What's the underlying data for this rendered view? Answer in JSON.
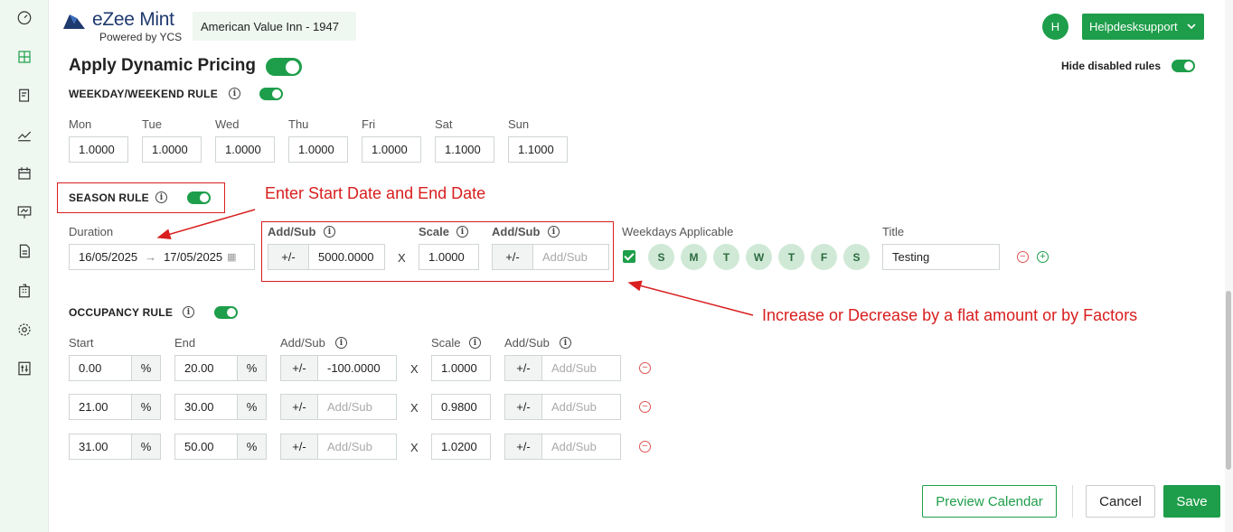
{
  "header": {
    "logo_title": "eZee Mint",
    "logo_subtitle": "Powered by YCS",
    "property": "American Value Inn - 1947",
    "avatar_initial": "H",
    "user": "Helpdesksupport"
  },
  "page": {
    "title": "Apply Dynamic Pricing",
    "hide_disabled_label": "Hide disabled rules"
  },
  "weekday_rule": {
    "heading": "WEEKDAY/WEEKEND RULE",
    "days": [
      {
        "label": "Mon",
        "value": "1.0000"
      },
      {
        "label": "Tue",
        "value": "1.0000"
      },
      {
        "label": "Wed",
        "value": "1.0000"
      },
      {
        "label": "Thu",
        "value": "1.0000"
      },
      {
        "label": "Fri",
        "value": "1.0000"
      },
      {
        "label": "Sat",
        "value": "1.1000"
      },
      {
        "label": "Sun",
        "value": "1.1000"
      }
    ]
  },
  "season_rule": {
    "heading": "SEASON RULE",
    "duration_label": "Duration",
    "start_date": "16/05/2025",
    "end_date": "17/05/2025",
    "addsub_label": "Add/Sub",
    "sign": "+/-",
    "addsub_value": "5000.0000",
    "scale_label": "Scale",
    "scale_value": "1.0000",
    "addsub2_label": "Add/Sub",
    "addsub2_placeholder": "Add/Sub",
    "weekdays_label": "Weekdays Applicable",
    "weekday_letters": [
      "S",
      "M",
      "T",
      "W",
      "T",
      "F",
      "S"
    ],
    "title_label": "Title",
    "title_value": "Testing"
  },
  "annotations": {
    "dates": "Enter Start Date and End Date",
    "factors": "Increase or Decrease by a flat amount or by Factors"
  },
  "occupancy_rule": {
    "heading": "OCCUPANCY RULE",
    "col_start": "Start",
    "col_end": "End",
    "col_addsub": "Add/Sub",
    "col_scale": "Scale",
    "col_addsub2": "Add/Sub",
    "percent": "%",
    "sign": "+/-",
    "placeholder": "Add/Sub",
    "x": "X",
    "rows": [
      {
        "start": "0.00",
        "end": "20.00",
        "addsub": "-100.0000",
        "scale": "1.0000"
      },
      {
        "start": "21.00",
        "end": "30.00",
        "addsub": "",
        "scale": "0.9800"
      },
      {
        "start": "31.00",
        "end": "50.00",
        "addsub": "",
        "scale": "1.0200"
      }
    ]
  },
  "footer": {
    "preview": "Preview Calendar",
    "cancel": "Cancel",
    "save": "Save"
  },
  "colors": {
    "accent": "#1e9e4a",
    "annotation": "#d81e1e"
  }
}
